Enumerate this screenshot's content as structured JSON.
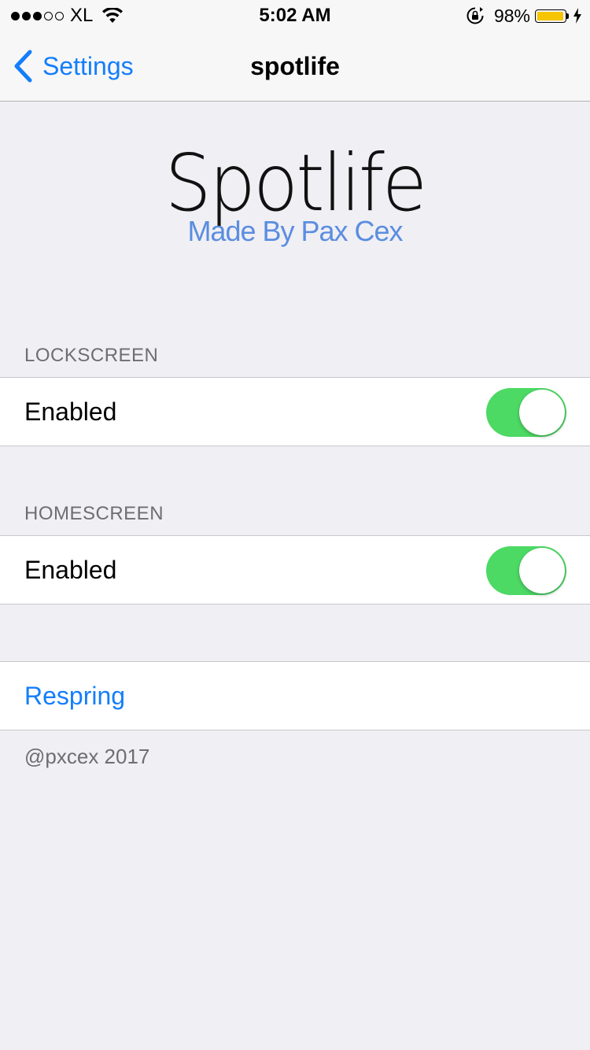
{
  "status_bar": {
    "carrier": "XL",
    "time": "5:02 AM",
    "battery_percent": "98%",
    "signal_bars_filled": 3,
    "signal_bars_total": 5,
    "battery_level": 0.98,
    "battery_color": "#f5c500"
  },
  "nav": {
    "back_label": "Settings",
    "title": "spotlife"
  },
  "header": {
    "logo": "Spotlife",
    "subtitle": "Made By Pax Cex",
    "subtitle_color": "#5b8de0"
  },
  "sections": [
    {
      "header": "LOCKSCREEN",
      "cell_label": "Enabled",
      "toggle_on": true
    },
    {
      "header": "HOMESCREEN",
      "cell_label": "Enabled",
      "toggle_on": true
    }
  ],
  "actions": {
    "respring_label": "Respring"
  },
  "footer": "@pxcex 2017",
  "colors": {
    "accent": "#147efb",
    "toggle_on": "#4cd964",
    "background": "#efeff4"
  }
}
